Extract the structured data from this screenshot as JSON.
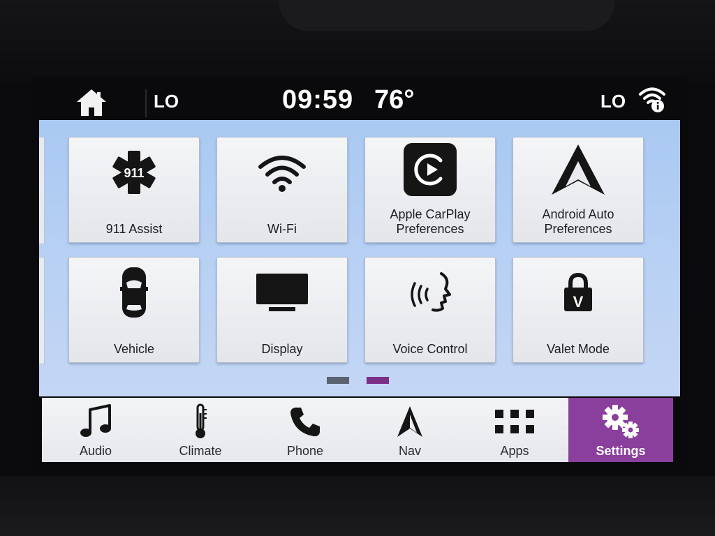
{
  "status": {
    "left_temp": "LO",
    "time": "09:59",
    "outside_temp": "76°",
    "right_temp": "LO",
    "icons": [
      "home-icon",
      "wifi-info-icon"
    ]
  },
  "tiles": [
    {
      "label": "911 Assist",
      "icon": "star-of-life-911-icon",
      "badge": "911"
    },
    {
      "label": "Wi-Fi",
      "icon": "wifi-icon"
    },
    {
      "label": "Apple CarPlay\nPreferences",
      "icon": "carplay-icon"
    },
    {
      "label": "Android Auto\nPreferences",
      "icon": "android-auto-icon"
    },
    {
      "label": "Vehicle",
      "icon": "car-top-view-icon"
    },
    {
      "label": "Display",
      "icon": "monitor-icon"
    },
    {
      "label": "Voice Control",
      "icon": "voice-speaking-icon"
    },
    {
      "label": "Valet Mode",
      "icon": "padlock-icon",
      "badge": "V"
    }
  ],
  "pager": {
    "pages": 2,
    "current": 2,
    "colors": [
      "#5a6470",
      "#7b2f86"
    ]
  },
  "nav": [
    {
      "label": "Audio",
      "icon": "music-note-icon"
    },
    {
      "label": "Climate",
      "icon": "thermometer-icon"
    },
    {
      "label": "Phone",
      "icon": "phone-icon"
    },
    {
      "label": "Nav",
      "icon": "nav-arrow-icon"
    },
    {
      "label": "Apps",
      "icon": "apps-grid-icon"
    },
    {
      "label": "Settings",
      "icon": "gears-icon",
      "active": true
    }
  ],
  "colors": {
    "accent": "#8a3f9c",
    "content_bg": "#b4cdf3",
    "tile_bg": "#eceef1"
  }
}
